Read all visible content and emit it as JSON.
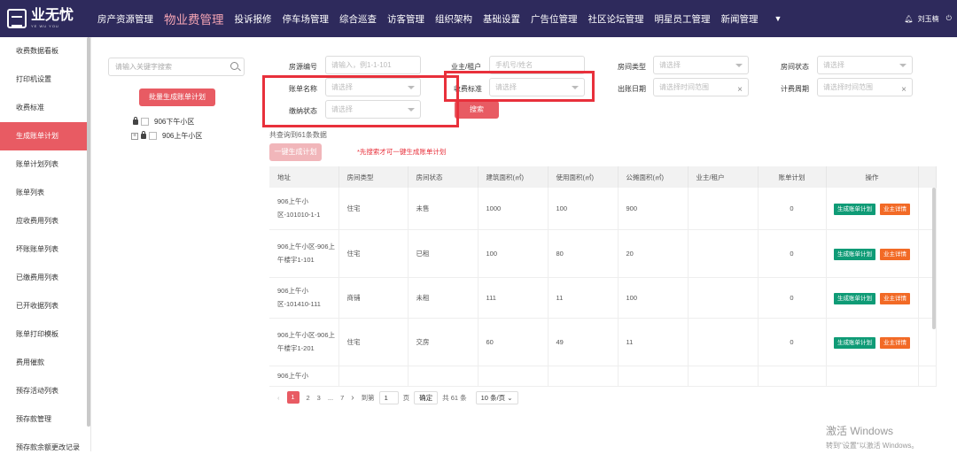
{
  "brand": {
    "name": "业无忧",
    "sub": "YE WU YOU"
  },
  "nav": {
    "items": [
      "房产资源管理",
      "物业费管理",
      "投诉报修",
      "停车场管理",
      "综合巡查",
      "访客管理",
      "组织架构",
      "基础设置",
      "广告位管理",
      "社区论坛管理",
      "明星员工管理",
      "新闻管理"
    ],
    "active_index": 1,
    "more_icon": "caret-down-icon"
  },
  "user": {
    "name": "刘玉楠",
    "bell_icon": "bell-icon",
    "power_icon": "power-icon"
  },
  "sidebar": {
    "items": [
      "收费数据看板",
      "打印机设置",
      "收费标准",
      "生成账单计划",
      "账单计划列表",
      "账单列表",
      "应收费用列表",
      "坏账账单列表",
      "已缴费用列表",
      "已开收据列表",
      "账单打印模板",
      "费用催款",
      "预存活动列表",
      "预存款管理",
      "预存款余额更改记录"
    ],
    "active_index": 3
  },
  "tree": {
    "search_placeholder": "请输入关键字搜索",
    "batch_button": "批量生成账单计划",
    "nodes": [
      "906下午小区",
      "906上午小区"
    ]
  },
  "filters": {
    "room_no": {
      "label": "房源编号",
      "placeholder": "请输入，例1-1-101"
    },
    "owner": {
      "label": "业主/租户",
      "placeholder": "手机号/姓名"
    },
    "room_type": {
      "label": "房间类型",
      "placeholder": "请选择"
    },
    "room_status": {
      "label": "房间状态",
      "placeholder": "请选择"
    },
    "bill_name": {
      "label": "账单名称",
      "placeholder": "请选择"
    },
    "fee_standard": {
      "label": "收费标准",
      "placeholder": "请选择"
    },
    "bill_date": {
      "label": "出账日期",
      "placeholder": "请选择时间范围"
    },
    "billing_cycle": {
      "label": "计费周期",
      "placeholder": "请选择时间范围"
    },
    "payment_status": {
      "label": "缴纳状态",
      "placeholder": "请选择"
    },
    "search_button": "搜索"
  },
  "result_count": "共查询到61条数据",
  "one_click_button": "一键生成计划",
  "hint": "*先搜索才可一键生成账单计划",
  "table": {
    "headers": [
      "地址",
      "房间类型",
      "房间状态",
      "建筑面积(㎡)",
      "使用面积(㎡)",
      "公摊面积(㎡)",
      "业主/租户",
      "账单计划",
      "操作"
    ],
    "rows": [
      {
        "address": "906上午小区-101010-1-1",
        "type": "住宅",
        "status": "未售",
        "built": "1000",
        "used": "100",
        "shared": "900",
        "owner": "",
        "plan": "0"
      },
      {
        "address": "906上午小区-906上午楼宇1-101",
        "type": "住宅",
        "status": "已租",
        "built": "100",
        "used": "80",
        "shared": "20",
        "owner": "",
        "plan": "0"
      },
      {
        "address": "906上午小区-101410-111",
        "type": "商铺",
        "status": "未租",
        "built": "111",
        "used": "11",
        "shared": "100",
        "owner": "",
        "plan": "0"
      },
      {
        "address": "906上午小区-906上午楼宇1-201",
        "type": "住宅",
        "status": "交房",
        "built": "60",
        "used": "49",
        "shared": "11",
        "owner": "",
        "plan": "0"
      },
      {
        "address": "906上午小",
        "type": "",
        "status": "",
        "built": "",
        "used": "",
        "shared": "",
        "owner": "",
        "plan": ""
      }
    ],
    "action_generate": "生成账单计划",
    "action_detail": "业主详情"
  },
  "pager": {
    "prev": "‹",
    "pages": [
      "1",
      "2",
      "3",
      "...",
      "7"
    ],
    "next": "›",
    "goto_label": "到第",
    "goto_value": "1",
    "page_label": "页",
    "confirm": "确定",
    "total": "共 61 条",
    "size": "10 条/页"
  },
  "watermark": {
    "line1": "激活 Windows",
    "line2": "转到\"设置\"以激活 Windows。"
  },
  "colors": {
    "topbar": "#2e2a5c",
    "accent": "#e85b63",
    "highlight": "#e8303b",
    "tag_green": "#0f9b76",
    "tag_orange": "#f26a26"
  }
}
